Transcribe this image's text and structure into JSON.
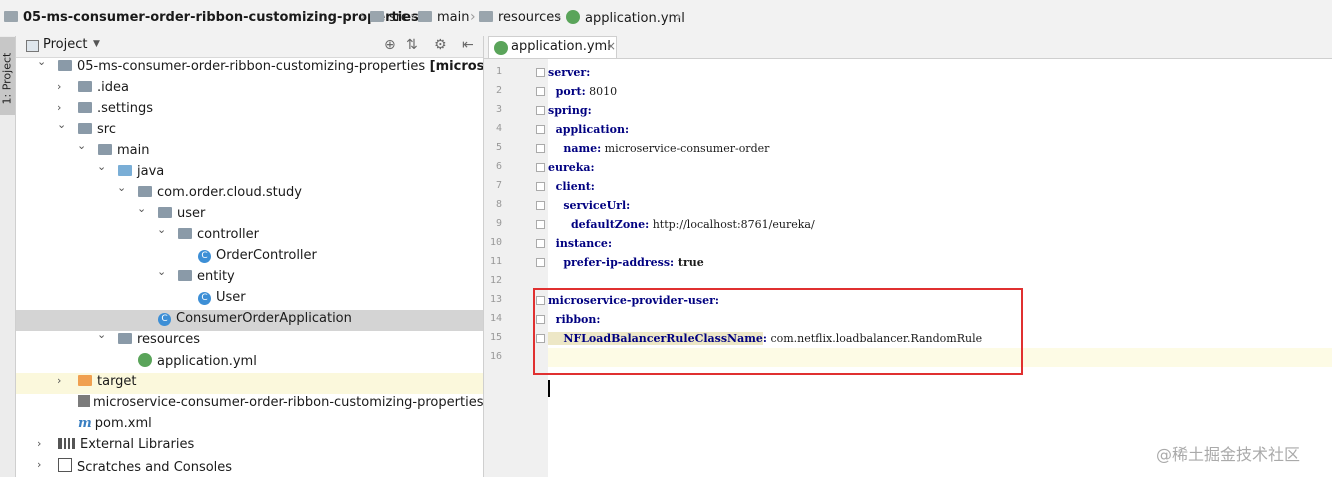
{
  "breadcrumb": {
    "items": [
      "05-ms-consumer-order-ribbon-customizing-properties",
      "src",
      "main",
      "resources",
      "application.yml"
    ]
  },
  "side_tab": "1: Project",
  "project_panel": {
    "title": "Project",
    "tree": [
      {
        "label": "05-ms-consumer-order-ribbon-customizing-properties",
        "suffix": "[microservice-con",
        "icon": "module-folder-icon",
        "expanded": true
      },
      {
        "label": ".idea",
        "icon": "folder-icon",
        "expanded": false
      },
      {
        "label": ".settings",
        "icon": "folder-icon",
        "expanded": false
      },
      {
        "label": "src",
        "icon": "folder-icon",
        "expanded": true
      },
      {
        "label": "main",
        "icon": "folder-icon",
        "expanded": true
      },
      {
        "label": "java",
        "icon": "source-folder-icon",
        "expanded": true
      },
      {
        "label": "com.order.cloud.study",
        "icon": "package-icon",
        "expanded": true
      },
      {
        "label": "user",
        "icon": "package-icon",
        "expanded": true
      },
      {
        "label": "controller",
        "icon": "package-icon",
        "expanded": true
      },
      {
        "label": "OrderController",
        "icon": "java-class-icon"
      },
      {
        "label": "entity",
        "icon": "package-icon",
        "expanded": true
      },
      {
        "label": "User",
        "icon": "java-class-icon"
      },
      {
        "label": "ConsumerOrderApplication",
        "icon": "spring-boot-class-icon",
        "selected": true
      },
      {
        "label": "resources",
        "icon": "resources-folder-icon",
        "expanded": true
      },
      {
        "label": "application.yml",
        "icon": "yaml-file-icon"
      },
      {
        "label": "target",
        "icon": "excluded-folder-icon",
        "expanded": false
      },
      {
        "label": "microservice-consumer-order-ribbon-customizing-properties.iml",
        "icon": "iml-file-icon"
      },
      {
        "label": "pom.xml",
        "icon": "maven-file-icon"
      },
      {
        "label": "External Libraries",
        "icon": "libraries-icon",
        "expanded": false
      },
      {
        "label": "Scratches and Consoles",
        "icon": "scratches-icon",
        "expanded": false
      }
    ]
  },
  "editor": {
    "tab": "application.yml",
    "lines": [
      {
        "n": "1",
        "key": "server",
        "sep": ":",
        "value": ""
      },
      {
        "n": "2",
        "key": "  port",
        "sep": ":",
        "value": " 8010"
      },
      {
        "n": "3",
        "key": "spring",
        "sep": ":",
        "value": ""
      },
      {
        "n": "4",
        "key": "  application",
        "sep": ":",
        "value": ""
      },
      {
        "n": "5",
        "key": "    name",
        "sep": ":",
        "value": " microservice-consumer-order"
      },
      {
        "n": "6",
        "key": "eureka",
        "sep": ":",
        "value": ""
      },
      {
        "n": "7",
        "key": "  client",
        "sep": ":",
        "value": ""
      },
      {
        "n": "8",
        "key": "    serviceUrl",
        "sep": ":",
        "value": ""
      },
      {
        "n": "9",
        "key": "      defaultZone",
        "sep": ":",
        "value": " http://localhost:8761/eureka/"
      },
      {
        "n": "10",
        "key": "  instance",
        "sep": ":",
        "value": ""
      },
      {
        "n": "11",
        "key": "    prefer-ip-address",
        "sep": ":",
        "value": " true"
      },
      {
        "n": "12",
        "key": "",
        "sep": "",
        "value": ""
      },
      {
        "n": "13",
        "key": "microservice-provider-user",
        "sep": ":",
        "value": ""
      },
      {
        "n": "14",
        "key": "  ribbon",
        "sep": ":",
        "value": ""
      },
      {
        "n": "15",
        "key": "    NFLoadBalancerRuleClassName",
        "sep": ":",
        "value": " com.netflix.loadbalancer.RandomRule"
      },
      {
        "n": "16",
        "key": "",
        "sep": "",
        "value": ""
      }
    ]
  },
  "watermark": "@稀土掘金技术社区"
}
